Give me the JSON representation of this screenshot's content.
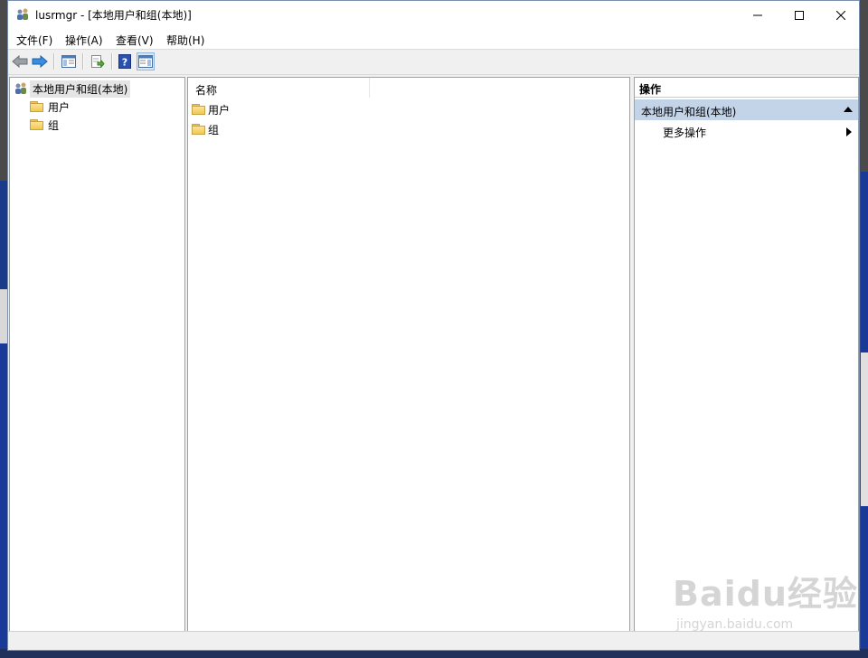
{
  "window": {
    "title": "lusrmgr - [本地用户和组(本地)]",
    "controls": {
      "minimize": "—",
      "maximize": "☐",
      "close": "✕"
    }
  },
  "menu": [
    {
      "label": "文件(F)"
    },
    {
      "label": "操作(A)"
    },
    {
      "label": "查看(V)"
    },
    {
      "label": "帮助(H)"
    }
  ],
  "toolbar": {
    "buttons": [
      "back-icon",
      "forward-icon",
      "show-hide-tree-icon",
      "export-list-icon",
      "help-icon",
      "show-hide-action-pane-icon"
    ]
  },
  "tree": {
    "root": "本地用户和组(本地)",
    "items": [
      {
        "label": "用户"
      },
      {
        "label": "组"
      }
    ]
  },
  "list": {
    "columns": [
      "名称"
    ],
    "rows": [
      {
        "name": "用户"
      },
      {
        "name": "组"
      }
    ]
  },
  "actions": {
    "header": "操作",
    "section": "本地用户和组(本地)",
    "items": [
      {
        "label": "更多操作"
      }
    ]
  },
  "watermark": {
    "main": "Baidu经验",
    "sub": "jingyan.baidu.com"
  },
  "colors": {
    "accent": "#1e7ad8",
    "section_bg": "#c3d3e8",
    "folder": "#f2c94c"
  }
}
